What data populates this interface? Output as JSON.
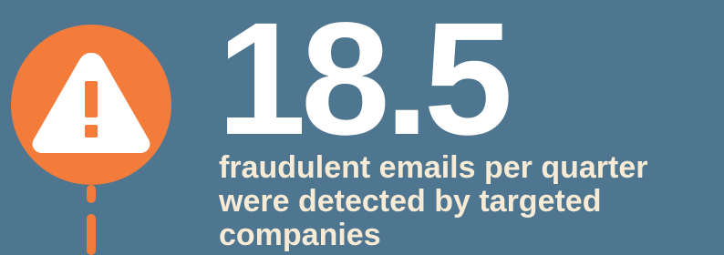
{
  "stat": {
    "value": "18.5",
    "caption_lines": [
      "fraudulent emails per quarter",
      "were detected by targeted",
      "companies"
    ]
  },
  "icons": {
    "alert": "warning-triangle-icon"
  },
  "colors": {
    "background": "#4f7690",
    "accent": "#f47c3b",
    "number": "#ffffff",
    "caption": "#f7ebd6"
  }
}
